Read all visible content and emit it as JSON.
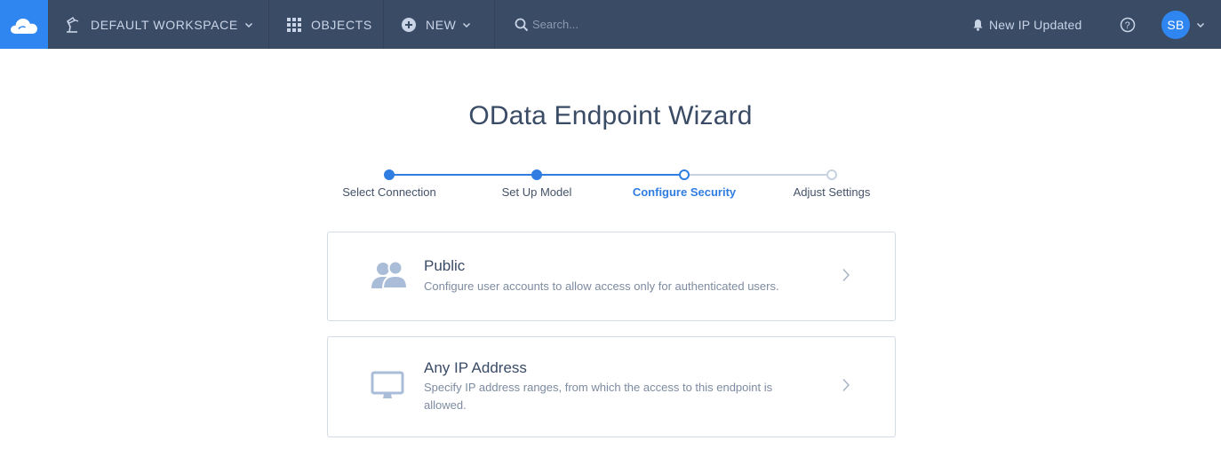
{
  "nav": {
    "workspace_label": "DEFAULT WORKSPACE",
    "objects_label": "OBJECTS",
    "new_label": "NEW",
    "search_placeholder": "Search...",
    "notification_label": "New IP Updated",
    "help_glyph": "?",
    "avatar_initials": "SB"
  },
  "page": {
    "title": "OData Endpoint Wizard"
  },
  "steps": [
    {
      "label": "Select Connection",
      "state": "done"
    },
    {
      "label": "Set Up Model",
      "state": "done"
    },
    {
      "label": "Configure Security",
      "state": "current"
    },
    {
      "label": "Adjust Settings",
      "state": "future"
    }
  ],
  "options": [
    {
      "title": "Public",
      "description": "Configure user accounts to allow access only for authenticated users.",
      "icon": "users-icon"
    },
    {
      "title": "Any IP Address",
      "description": "Specify IP address ranges, from which the access to this endpoint is allowed.",
      "icon": "monitor-icon"
    }
  ],
  "colors": {
    "topbar": "#3a4b66",
    "accent": "#2f86f0",
    "step_active": "#2f7de1",
    "step_inactive": "#c6d2e0"
  }
}
